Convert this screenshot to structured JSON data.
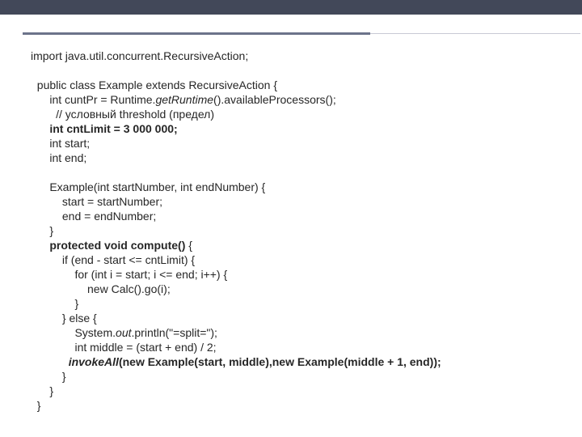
{
  "code": {
    "l01a": "import java.util.concurrent.RecursiveAction;",
    "l02": "",
    "l03": "  public class Example extends RecursiveAction {",
    "l04a": "      int cuntPr = Runtime.",
    "l04b": "getRuntime",
    "l04c": "().availableProcessors();",
    "l05": "        // условный threshold (предел)",
    "l06": "      int cntLimit = 3 000 000;",
    "l07": "      int start;",
    "l08": "      int end;",
    "l09": "",
    "l10": "      Example(int startNumber, int endNumber) {",
    "l11": "          start = startNumber;",
    "l12": "          end = endNumber;",
    "l13": "      }",
    "l14a": "      ",
    "l14b": "protected void compute()",
    "l14c": " {",
    "l15": "          if (end - start <= cntLimit) {",
    "l16": "              for (int i = start; i <= end; i++) {",
    "l17": "                  new Calc().go(i);",
    "l18": "              }",
    "l19": "          } else {",
    "l20a": "              System.",
    "l20b": "out",
    "l20c": ".println(\"=split=\");",
    "l21": "              int middle = (start + end) / 2;",
    "l22a": "            ",
    "l22b": "invokeAll",
    "l22c": "(new Example(start, middle),new Example(middle + 1, end));",
    "l23": "          }",
    "l24": "      }",
    "l25": "  }"
  }
}
